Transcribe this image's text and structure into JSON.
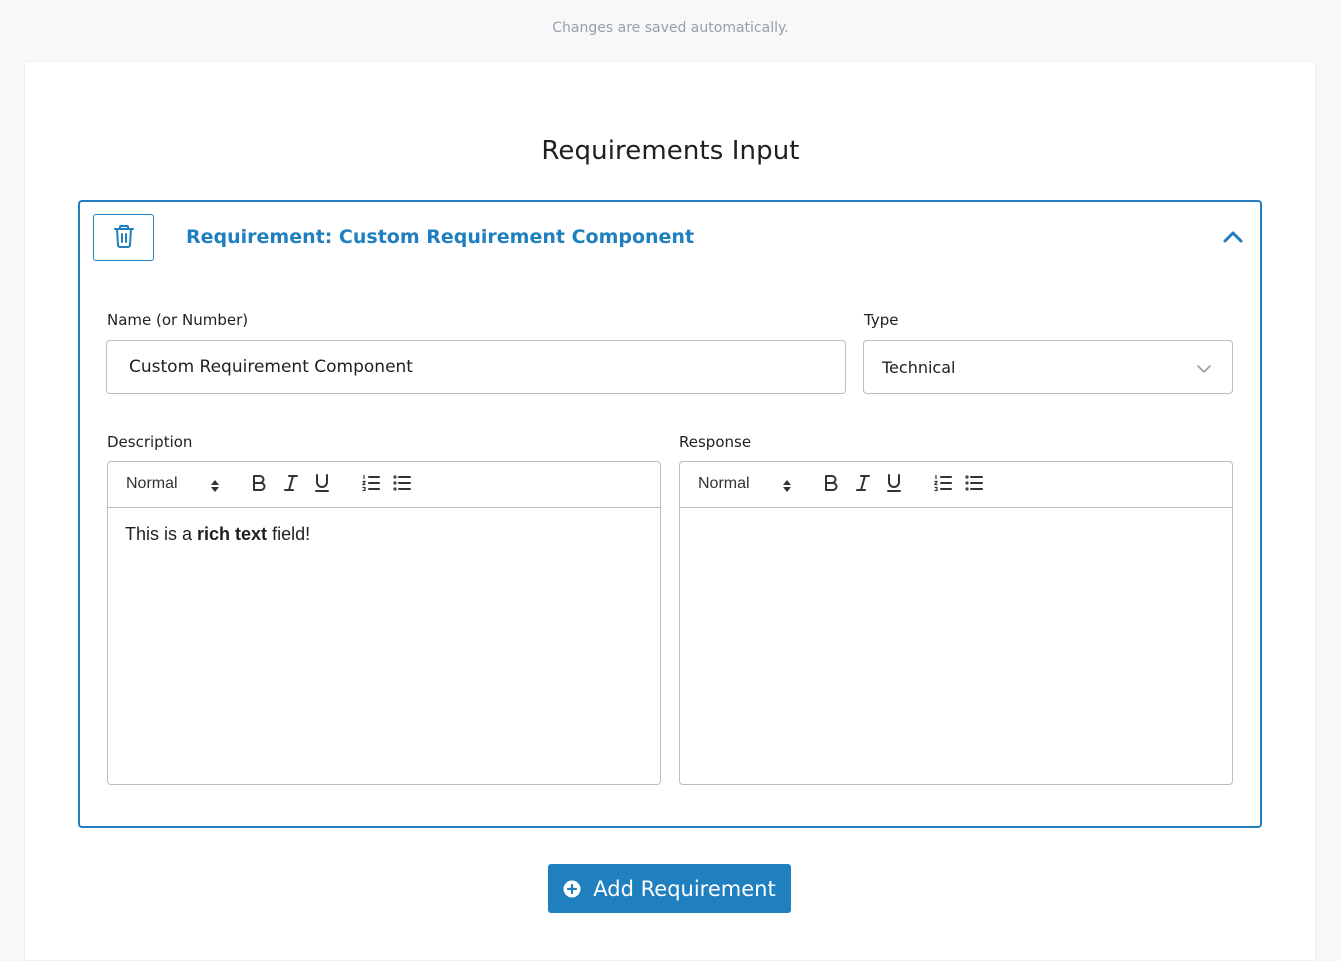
{
  "header": {
    "autosave_text": "Changes are saved automatically."
  },
  "page": {
    "title": "Requirements Input"
  },
  "requirement": {
    "header_title": "Requirement: Custom Requirement Component",
    "delete_icon": "trash-icon",
    "collapse_icon": "chevron-up-icon",
    "name_label": "Name (or Number)",
    "name_value": "Custom Requirement Component",
    "type_label": "Type",
    "type_value": "Technical",
    "description_label": "Description",
    "description_text_before": "This is a ",
    "description_text_bold": "rich text",
    "description_text_after": " field!",
    "response_label": "Response",
    "response_text": ""
  },
  "editor_toolbar": {
    "format_label": "Normal",
    "icons": [
      "bold-icon",
      "italic-icon",
      "underline-icon",
      "ordered-list-icon",
      "bullet-list-icon"
    ]
  },
  "actions": {
    "add_requirement_label": "Add Requirement",
    "add_icon": "plus-circle-icon"
  },
  "colors": {
    "accent": "#1f7fbf",
    "border": "#b9bec5",
    "background": "#f7f8fa",
    "muted_text": "#9a9fa6"
  }
}
